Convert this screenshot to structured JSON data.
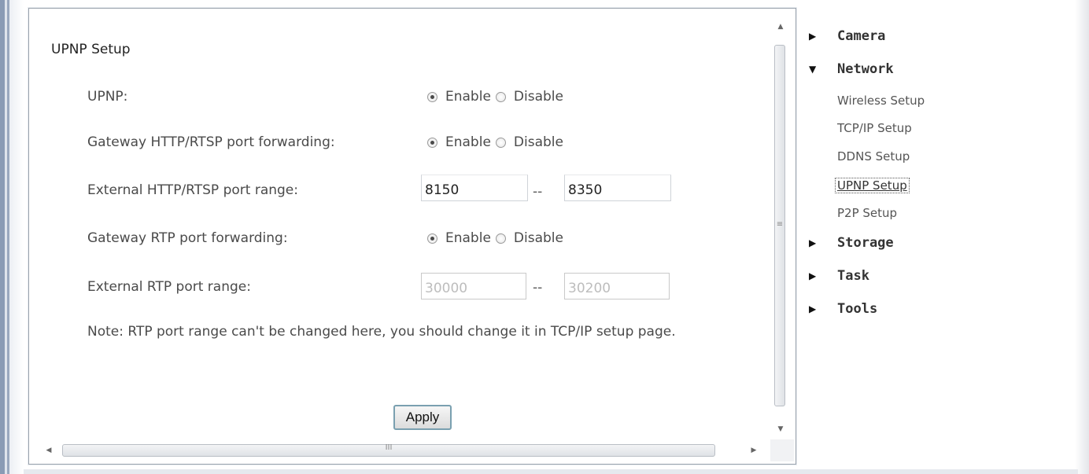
{
  "section": {
    "title": "UPNP Setup"
  },
  "rows": {
    "upnp": {
      "label": "UPNP:",
      "enable": "Enable",
      "disable": "Disable"
    },
    "gateway_http": {
      "label": "Gateway HTTP/RTSP port forwarding:",
      "enable": "Enable",
      "disable": "Disable"
    },
    "ext_http": {
      "label": "External HTTP/RTSP port range:",
      "from": "8150",
      "sep": "--",
      "to": "8350"
    },
    "gateway_rtp": {
      "label": "Gateway RTP port forwarding:",
      "enable": "Enable",
      "disable": "Disable"
    },
    "ext_rtp": {
      "label": "External RTP port range:",
      "from": "30000",
      "sep": "--",
      "to": "30200"
    }
  },
  "note": "Note: RTP port range can't be changed here, you should change it in TCP/IP setup page.",
  "apply_label": "Apply",
  "scroll": {
    "v_grip": "≡",
    "h_grip": "III"
  },
  "sidebar": {
    "camera": "Camera",
    "network": "Network",
    "network_items": [
      "Wireless Setup",
      "TCP/IP Setup",
      "DDNS Setup",
      "UPNP Setup",
      "P2P Setup"
    ],
    "storage": "Storage",
    "task": "Task",
    "tools": "Tools"
  }
}
